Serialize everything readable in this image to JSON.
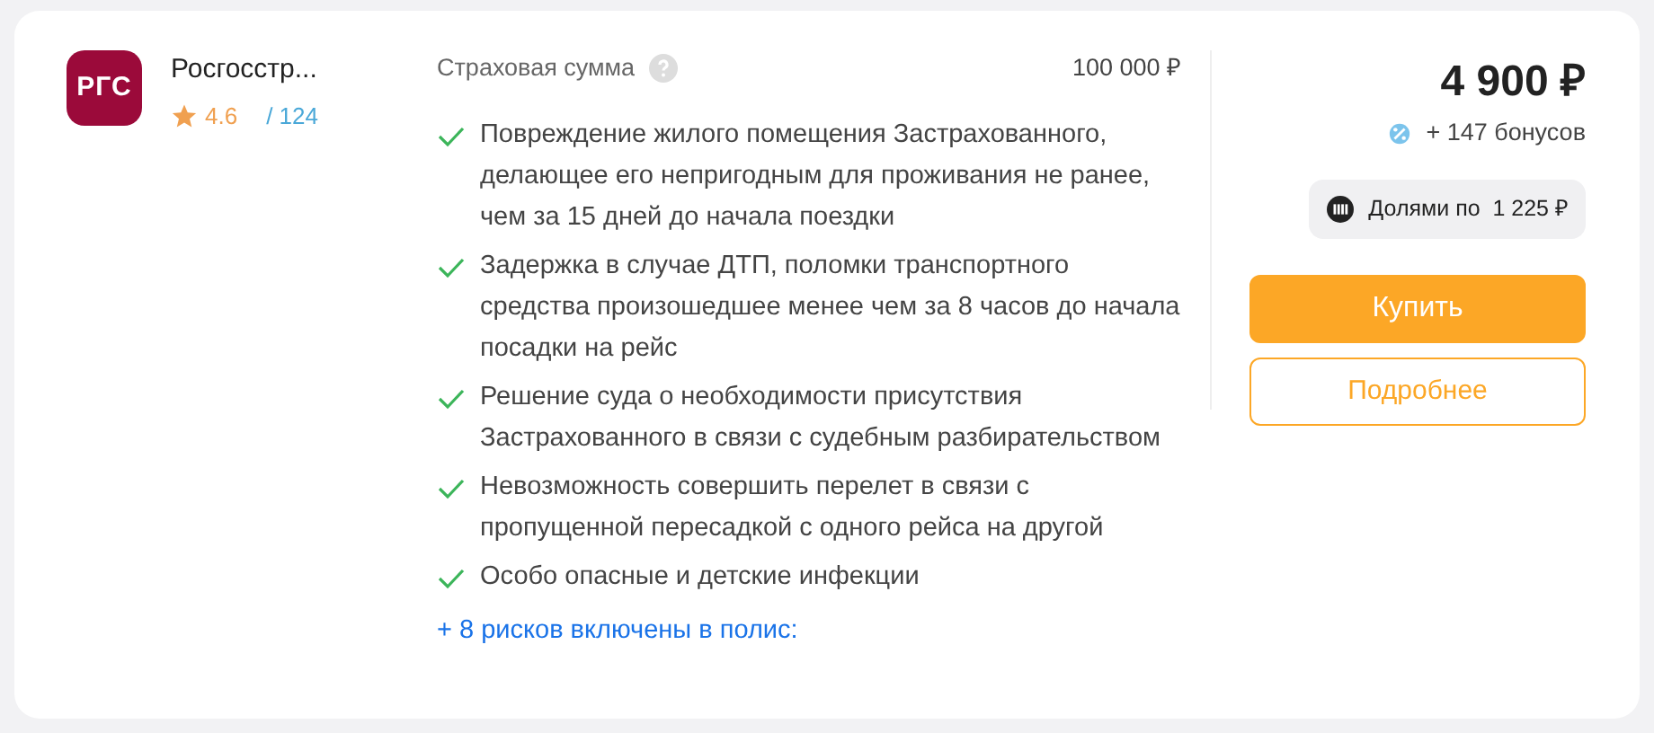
{
  "company": {
    "logo_text": "РГС",
    "name": "Росгосстр...",
    "rating": "4.6",
    "reviews": "/ 124"
  },
  "sum": {
    "label": "Страховая сумма",
    "value": "100 000 ₽"
  },
  "risks": [
    {
      "text": "Повреждение жилого помещения Застрахованного, делающее его непригодным для проживания не ранее, чем за 15 дней до начала поездки"
    },
    {
      "text": "Задержка в случае ДТП, поломки транспортного средства произошедшее менее чем за 8 часов до начала посадки на рейс"
    },
    {
      "text": "Решение суда о необходимости присутствия Застрахованного в связи с судебным разбирательством"
    },
    {
      "text": "Невозможность совершить перелет в связи с пропущенной пересадкой с одного рейса на другой"
    },
    {
      "text": "Особо опасные и детские инфекции"
    }
  ],
  "more_link": "+ 8 рисков включены в полис:",
  "price": "4 900 ₽",
  "bonus": "+ 147 бонусов",
  "installments": "Долями по  1 225 ₽",
  "buttons": [
    {
      "kind": "primary",
      "label": "Купить"
    },
    {
      "kind": "outline",
      "label": "Подробнее"
    }
  ]
}
